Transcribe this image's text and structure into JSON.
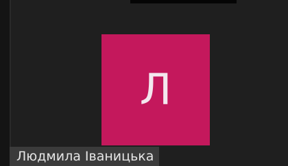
{
  "participant": {
    "avatar_initial": "Л",
    "name": "Людмила Іваницька"
  },
  "colors": {
    "background": "#1f1f1f",
    "avatar": "#c4185c",
    "avatar_text": "#f3e7ee",
    "name_label_bg": "#3b3b3b",
    "name_label_text": "#e6e6e6"
  }
}
